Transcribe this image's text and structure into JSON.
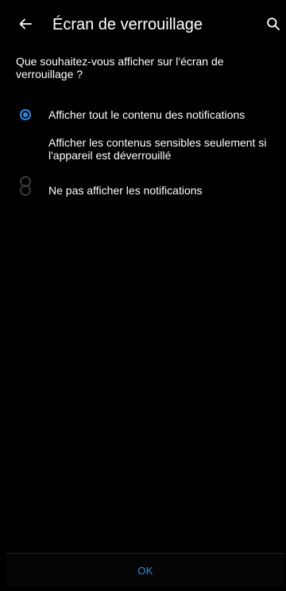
{
  "header": {
    "title": "Écran de verrouillage",
    "back_icon": "arrow-left-icon",
    "search_icon": "search-icon"
  },
  "question": "Que souhaitez-vous afficher sur l'écran de verrouillage ?",
  "options": [
    {
      "label": "Afficher tout le contenu des notifications",
      "selected": true
    },
    {
      "label": "Afficher les contenus sensibles seulement si l'appareil est déverrouillé",
      "selected": false
    },
    {
      "label": "Ne pas afficher les notifications",
      "selected": false
    }
  ],
  "footer": {
    "ok_label": "OK"
  },
  "colors": {
    "accent": "#2a8fe6",
    "background": "#000000",
    "text": "#ffffff",
    "radio_unchecked": "#3a3a3a"
  }
}
